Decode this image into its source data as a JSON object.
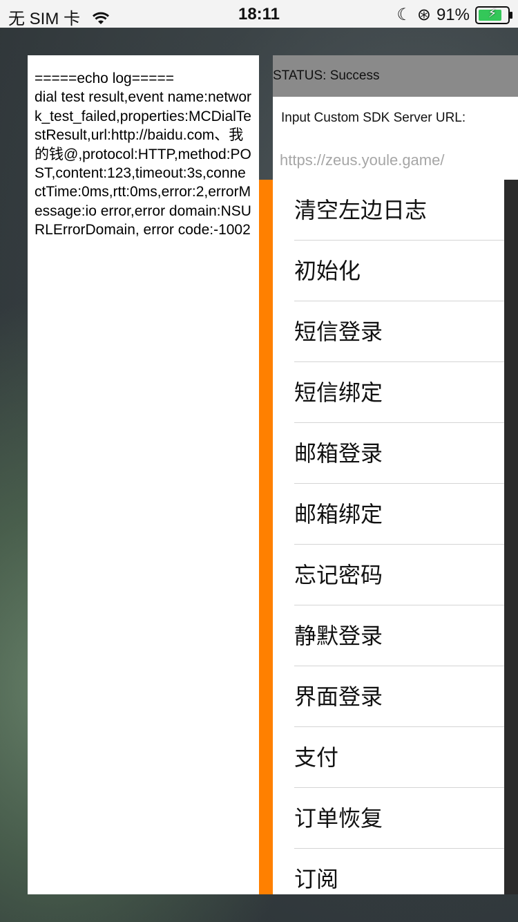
{
  "status_bar": {
    "carrier": "无 SIM 卡",
    "time": "18:11",
    "battery_percent_text": "91%",
    "battery_level": 0.91
  },
  "log_panel": {
    "text": "=====echo log=====\ndial test result,event name:network_test_failed,properties:MCDialTestResult,url:http://baidu.com、我的钱@,protocol:HTTP,method:POST,content:123,timeout:3s,connectTime:0ms,rtt:0ms,error:2,errorMessage:io error,error domain:NSURLErrorDomain, error code:-1002"
  },
  "status": {
    "text": "STATUS: Success"
  },
  "server_url": {
    "label": "Input Custom SDK Server URL:",
    "placeholder": "https://zeus.youle.game/"
  },
  "menu": {
    "items": [
      {
        "label": "清空左边日志"
      },
      {
        "label": "初始化"
      },
      {
        "label": "短信登录"
      },
      {
        "label": "短信绑定"
      },
      {
        "label": "邮箱登录"
      },
      {
        "label": "邮箱绑定"
      },
      {
        "label": "忘记密码"
      },
      {
        "label": "静默登录"
      },
      {
        "label": "界面登录"
      },
      {
        "label": "支付"
      },
      {
        "label": "订单恢复"
      },
      {
        "label": "订阅"
      }
    ]
  },
  "colors": {
    "accent_bar": "#ff8000",
    "status_strip": "#8a8a8a",
    "battery_fill": "#34c759"
  }
}
